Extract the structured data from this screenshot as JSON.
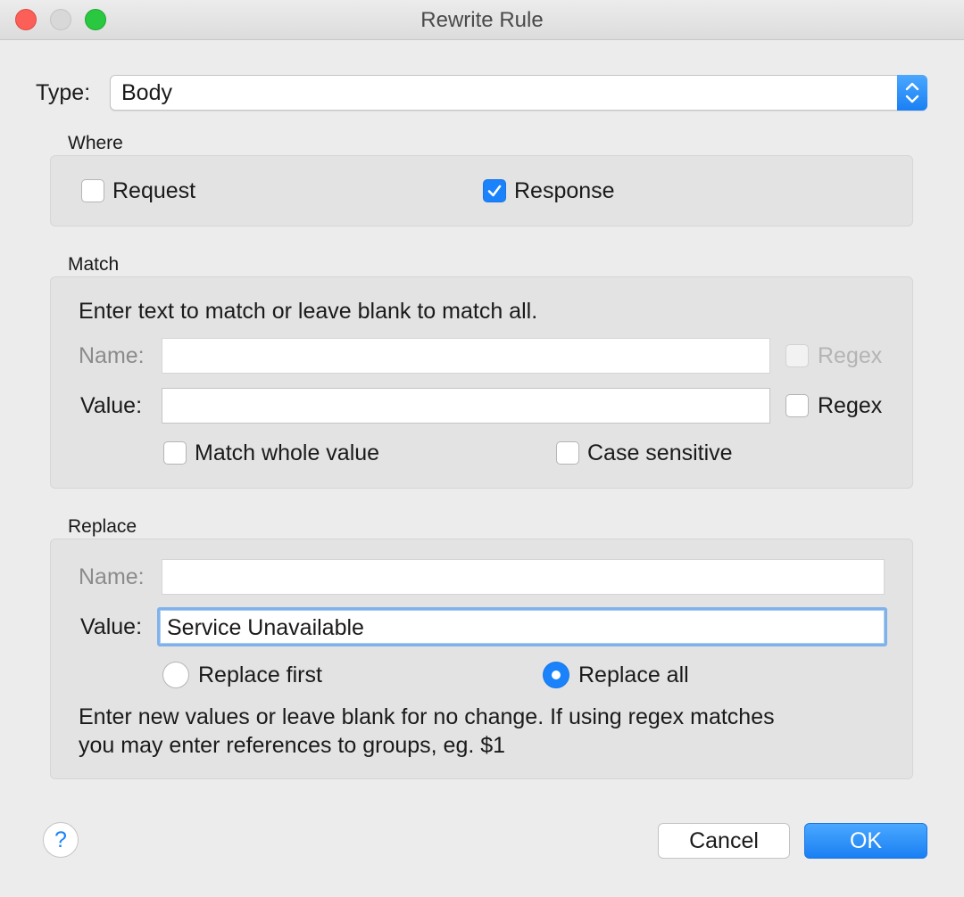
{
  "window": {
    "title": "Rewrite Rule"
  },
  "type": {
    "label": "Type:",
    "selected": "Body"
  },
  "where": {
    "title": "Where",
    "request": {
      "label": "Request",
      "checked": false
    },
    "response": {
      "label": "Response",
      "checked": true
    }
  },
  "match": {
    "title": "Match",
    "instructions": "Enter text to match or leave blank to match all.",
    "name_label": "Name:",
    "name_value": "",
    "name_regex_label": "Regex",
    "value_label": "Value:",
    "value_value": "",
    "value_regex_label": "Regex",
    "match_whole_label": "Match whole value",
    "case_sensitive_label": "Case sensitive"
  },
  "replace": {
    "title": "Replace",
    "name_label": "Name:",
    "name_value": "",
    "value_label": "Value:",
    "value_value": "Service Unavailable",
    "replace_first_label": "Replace first",
    "replace_all_label": "Replace all",
    "selected_mode": "Replace all",
    "help_line1": "Enter new values or leave blank for no change. If using regex matches",
    "help_line2": "you may enter references to groups, eg. $1"
  },
  "footer": {
    "help_symbol": "?",
    "cancel_label": "Cancel",
    "ok_label": "OK"
  },
  "colors": {
    "accent": "#1a82fb",
    "window_bg": "#ececec",
    "group_bg": "#e3e3e3",
    "close": "#fc5f57",
    "zoom": "#2ac840"
  }
}
